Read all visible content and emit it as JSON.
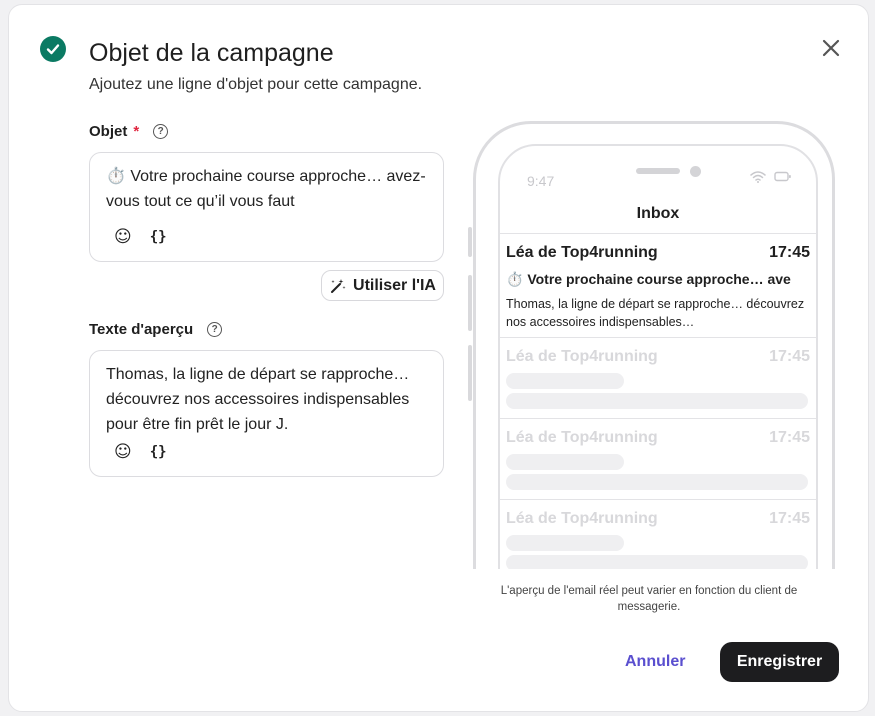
{
  "header": {
    "title": "Objet de la campagne",
    "subtitle": "Ajoutez une ligne d'objet pour cette campagne."
  },
  "subject_field": {
    "label": "Objet",
    "required_mark": "*",
    "value": "⏱️ Votre prochaine course approche… avez-vous tout ce qu’il vous faut",
    "emoji_tool": "☺",
    "variable_tool": "{}"
  },
  "ai_button": {
    "label": "Utiliser l'IA"
  },
  "preview_field": {
    "label": "Texte d'aperçu",
    "value": "Thomas, la ligne de départ se rapproche… découvrez nos accessoires indispensables pour être fin prêt le jour J.",
    "emoji_tool": "☺",
    "variable_tool": "{}"
  },
  "phone": {
    "time": "9:47",
    "inbox_title": "Inbox",
    "emails": [
      {
        "sender": "Léa de Top4running",
        "time": "17:45",
        "subject": "⏱️ Votre prochaine course approche… ave",
        "preview": "Thomas, la ligne de départ se rapproche… découvrez nos accessoires indispensables…"
      },
      {
        "sender": "Léa de Top4running",
        "time": "17:45"
      },
      {
        "sender": "Léa de Top4running",
        "time": "17:45"
      },
      {
        "sender": "Léa de Top4running",
        "time": "17:45"
      }
    ]
  },
  "disclaimer": "L'aperçu de l'email réel peut varier en fonction du client de messagerie.",
  "footer": {
    "cancel_label": "Annuler",
    "save_label": "Enregistrer"
  },
  "colors": {
    "accent": "#5a4fcf",
    "success": "#0b7a63",
    "required": "#e0263f",
    "primary_button": "#1d1d1f"
  }
}
